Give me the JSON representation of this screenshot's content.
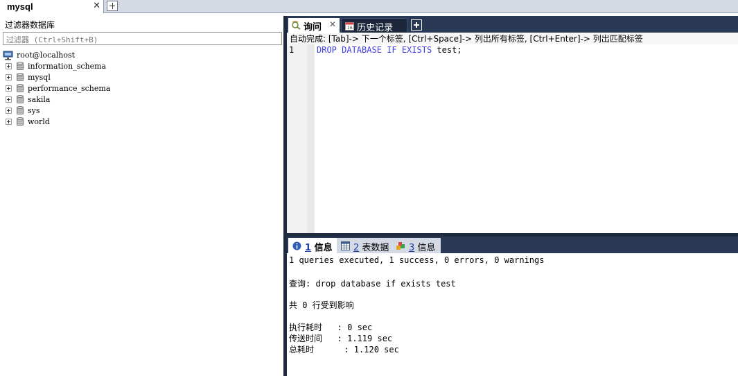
{
  "connection": {
    "tab_label": "mysql",
    "close": "✕"
  },
  "left_panel": {
    "title": "过滤器数据库",
    "filter_placeholder": "过滤器 (Ctrl+Shift+B)",
    "root": "root@localhost",
    "databases": [
      "information_schema",
      "mysql",
      "performance_schema",
      "sakila",
      "sys",
      "world"
    ]
  },
  "query_tabs": {
    "active": "询问",
    "active_close": "✕",
    "history": "历史记录"
  },
  "autocomplete_hint": "自动完成: [Tab]-> 下一个标签, [Ctrl+Space]-> 列出所有标签, [Ctrl+Enter]-> 列出匹配标签",
  "editor": {
    "line_number": "1",
    "keyword1": "DROP DATABASE IF EXISTS",
    "rest": " test;"
  },
  "result_tabs": [
    {
      "num": "1",
      "label": " 信息"
    },
    {
      "num": "2",
      "label": " 表数据"
    },
    {
      "num": "3",
      "label": " 信息"
    }
  ],
  "results": {
    "line1": "1 queries executed, 1 success, 0 errors, 0 warnings",
    "line2": "查询: drop database if exists test",
    "line3": "共 0 行受到影响",
    "line4": "执行耗时   : 0 sec",
    "line5": "传送时间   : 1.119 sec",
    "line6": "总耗时      : 1.120 sec"
  },
  "colors": {
    "dark_bar": "#293955",
    "splitter": "#1e2a3e",
    "keyword": "#3d3de0",
    "link": "#1a3fa8"
  }
}
